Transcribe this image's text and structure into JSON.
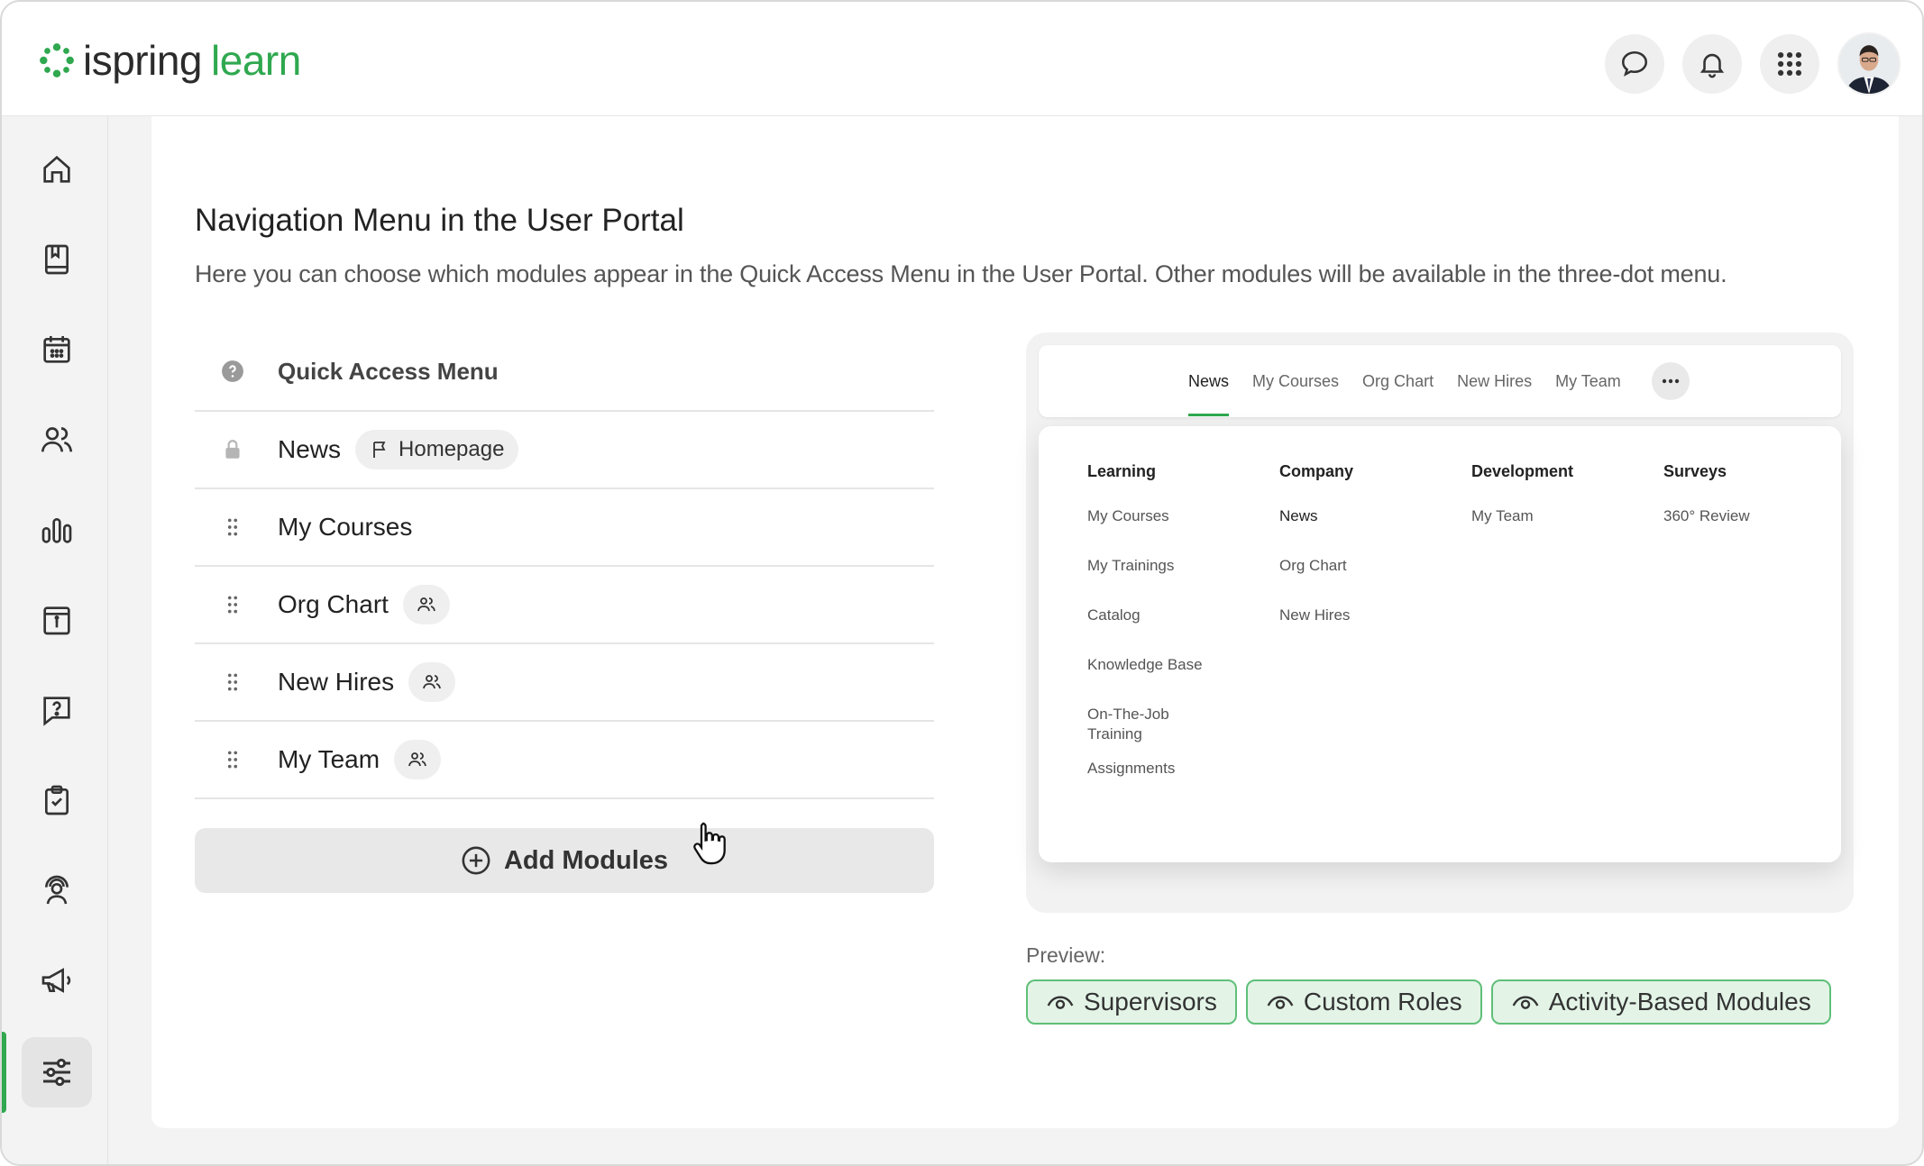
{
  "brand": {
    "word1": "ispring",
    "word2": "learn",
    "accent": "#2fa84f"
  },
  "header": {
    "icons": [
      "chat-icon",
      "bell-icon",
      "apps-grid-icon"
    ],
    "avatar": "user-avatar"
  },
  "sidebar": {
    "items": [
      {
        "icon": "home-icon"
      },
      {
        "icon": "book-icon"
      },
      {
        "icon": "calendar-icon"
      },
      {
        "icon": "users-icon"
      },
      {
        "icon": "bar-chart-icon"
      },
      {
        "icon": "info-icon"
      },
      {
        "icon": "question-icon"
      },
      {
        "icon": "clipboard-check-icon"
      },
      {
        "icon": "person-broadcast-icon"
      },
      {
        "icon": "megaphone-icon"
      },
      {
        "icon": "sliders-icon",
        "active": true
      }
    ]
  },
  "page": {
    "title": "Navigation Menu in the User Portal",
    "description": "Here you can choose which modules appear in the Quick Access Menu in the User Portal. Other modules will be available in the three-dot menu."
  },
  "quick_menu": {
    "header": "Quick Access Menu",
    "rows": [
      {
        "label": "News",
        "chip": "Homepage",
        "locked": true
      },
      {
        "label": "My Courses"
      },
      {
        "label": "Org Chart",
        "people_chip": true
      },
      {
        "label": "New Hires",
        "people_chip": true
      },
      {
        "label": "My Team",
        "people_chip": true
      }
    ],
    "add_button": "Add Modules"
  },
  "preview": {
    "nav": [
      "News",
      "My Courses",
      "Org Chart",
      "New Hires",
      "My Team"
    ],
    "active_nav": "News",
    "columns": [
      {
        "header": "Learning",
        "items": [
          "My Courses",
          "My Trainings",
          "Catalog",
          "Knowledge Base",
          "On-The-Job Training",
          "Assignments"
        ]
      },
      {
        "header": "Company",
        "items": [
          "News",
          "Org Chart",
          "New Hires"
        ]
      },
      {
        "header": "Development",
        "items": [
          "My Team"
        ]
      },
      {
        "header": "Surveys",
        "items": [
          "360° Review"
        ]
      }
    ],
    "label": "Preview:",
    "pills": [
      "Supervisors",
      "Custom Roles",
      "Activity-Based Modules"
    ]
  }
}
